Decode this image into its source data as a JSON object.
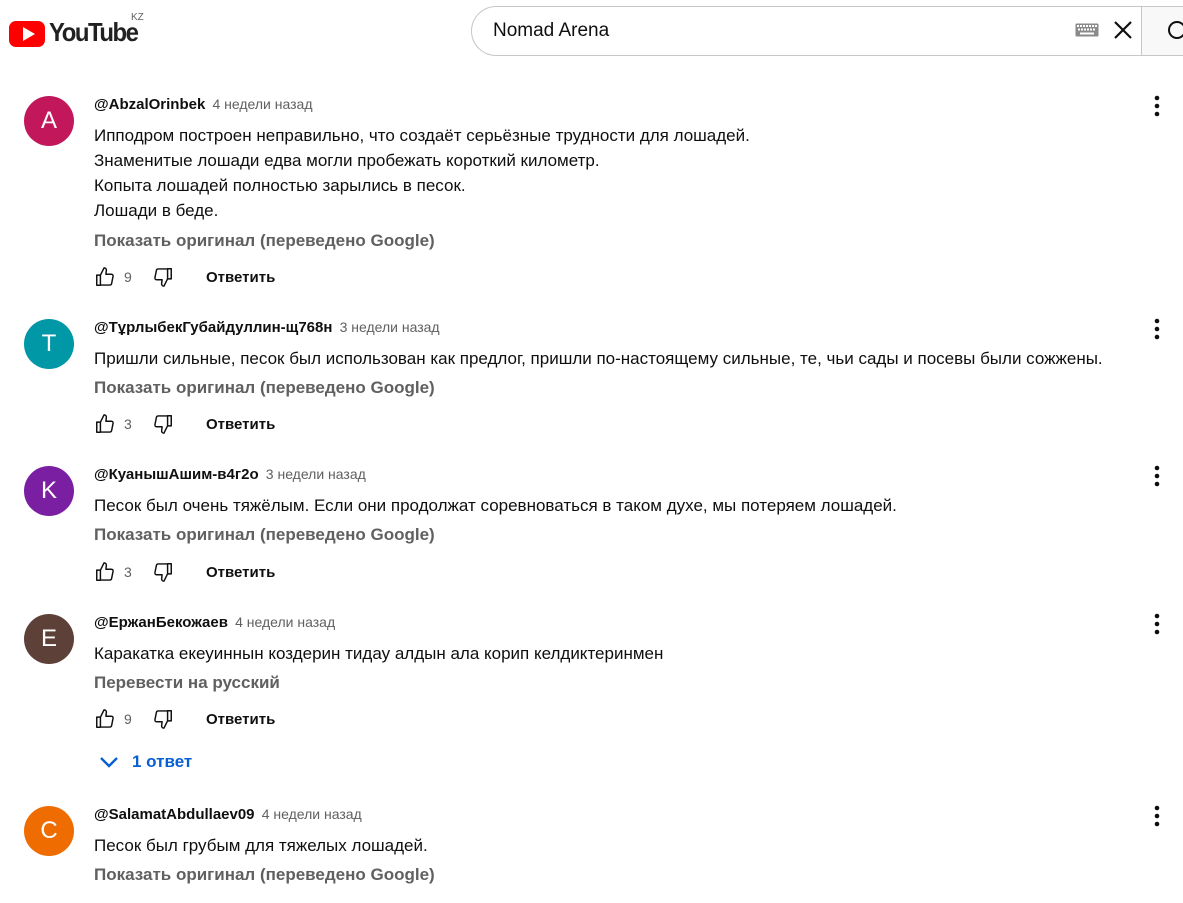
{
  "header": {
    "logo_text": "YouTube",
    "country_code": "KZ",
    "search_value": "Nomad Arena"
  },
  "comments": [
    {
      "avatar_letter": "A",
      "avatar_color": "#c2185b",
      "author": "@AbzalOrinbek",
      "time": "4 недели назад",
      "lines": [
        "Ипподром построен неправильно, что создаёт серьёзные трудности для лошадей.",
        "Знаменитые лошади едва могли пробежать короткий километр.",
        "Копыта лошадей полностью зарылись в песок.",
        "Лошади в беде."
      ],
      "translate_link": "Показать оригинал (переведено Google)",
      "likes": "9",
      "reply_label": "Ответить"
    },
    {
      "avatar_letter": "T",
      "avatar_color": "#0097a7",
      "author": "@ТұрлыбекГубайдуллин-щ768н",
      "time": "3 недели назад",
      "lines": [
        "Пришли сильные, песок был использован как предлог, пришли по-настоящему сильные, те, чьи сады и посевы были сожжены."
      ],
      "translate_link": "Показать оригинал (переведено Google)",
      "likes": "3",
      "reply_label": "Ответить"
    },
    {
      "avatar_letter": "K",
      "avatar_color": "#7b1fa2",
      "author": "@КуанышАшим-в4г2о",
      "time": "3 недели назад",
      "lines": [
        "Песок был очень тяжёлым. Если они продолжат соревноваться в таком духе, мы потеряем лошадей."
      ],
      "translate_link": "Показать оригинал (переведено Google)",
      "likes": "3",
      "reply_label": "Ответить"
    },
    {
      "avatar_letter": "E",
      "avatar_color": "#5d4037",
      "author": "@ЕржанБекожаев",
      "time": "4 недели назад",
      "lines": [
        "Каракатка екеуиннын коздерин тидау алдын ала корип келдиктеринмен"
      ],
      "translate_link": "Перевести на русский",
      "likes": "9",
      "reply_label": "Ответить",
      "replies_label": "1 ответ"
    },
    {
      "avatar_letter": "C",
      "avatar_color": "#ef6c00",
      "author": "@SalamatAbdullaev09",
      "time": "4 недели назад",
      "lines": [
        "Песок был грубым для тяжелых лошадей."
      ],
      "translate_link": "Показать оригинал (переведено Google)"
    }
  ]
}
